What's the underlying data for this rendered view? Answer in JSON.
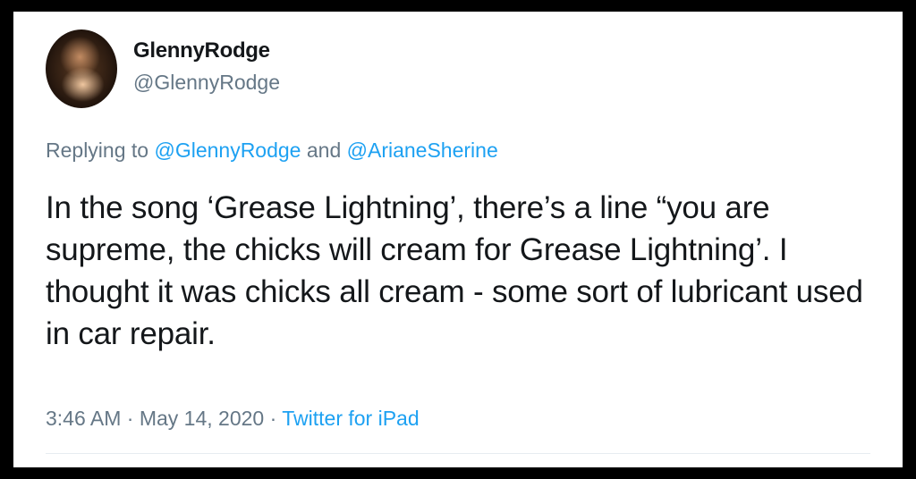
{
  "user": {
    "display_name": "GlennyRodge",
    "handle": "@GlennyRodge"
  },
  "reply": {
    "prefix": "Replying to ",
    "mention_1": "@GlennyRodge",
    "conjunction": " and ",
    "mention_2": "@ArianeSherine"
  },
  "tweet": {
    "text": "In the song ‘Grease Lightning’, there’s a line “you are supreme, the chicks will cream for Grease Lightning’. I thought it was chicks all cream - some sort of lubricant used in car repair."
  },
  "meta": {
    "time": "3:46 AM",
    "separator_1": " · ",
    "date": "May 14, 2020",
    "separator_2": " · ",
    "source": "Twitter for iPad"
  },
  "colors": {
    "link": "#1da1f2",
    "secondary_text": "#657786",
    "primary_text": "#14171a",
    "border": "#000000"
  }
}
